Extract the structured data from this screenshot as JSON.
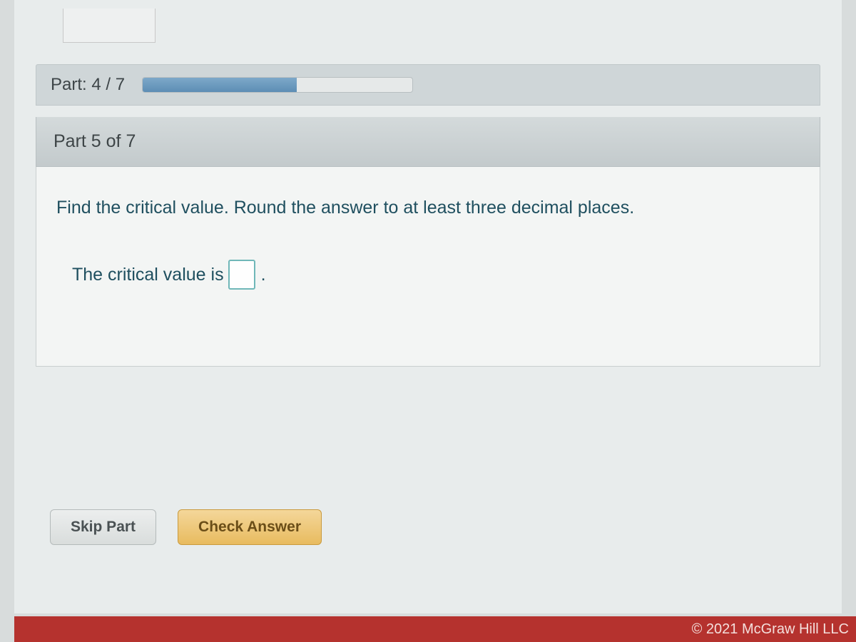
{
  "progress": {
    "label": "Part: 4 / 7",
    "percent": 57
  },
  "subpart": {
    "label": "Part 5 of 7"
  },
  "question": {
    "prompt": "Find the critical value. Round the answer to at least three decimal places.",
    "answer_prefix": "The critical value is",
    "answer_value": "",
    "answer_suffix": "."
  },
  "buttons": {
    "skip": "Skip Part",
    "check": "Check Answer"
  },
  "footer": {
    "copyright": "© 2021 McGraw Hill LLC"
  }
}
